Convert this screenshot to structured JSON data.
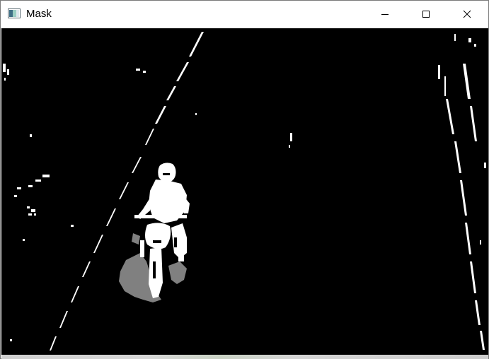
{
  "window": {
    "title": "Mask",
    "icon": "opencv-window-icon",
    "controls": {
      "minimize": "minimize-icon",
      "maximize": "maximize-icon",
      "close": "close-icon"
    }
  },
  "colors": {
    "background": "#000000",
    "foreground": "#ffffff",
    "shadow": "#808080",
    "titlebar": "#ffffff"
  }
}
